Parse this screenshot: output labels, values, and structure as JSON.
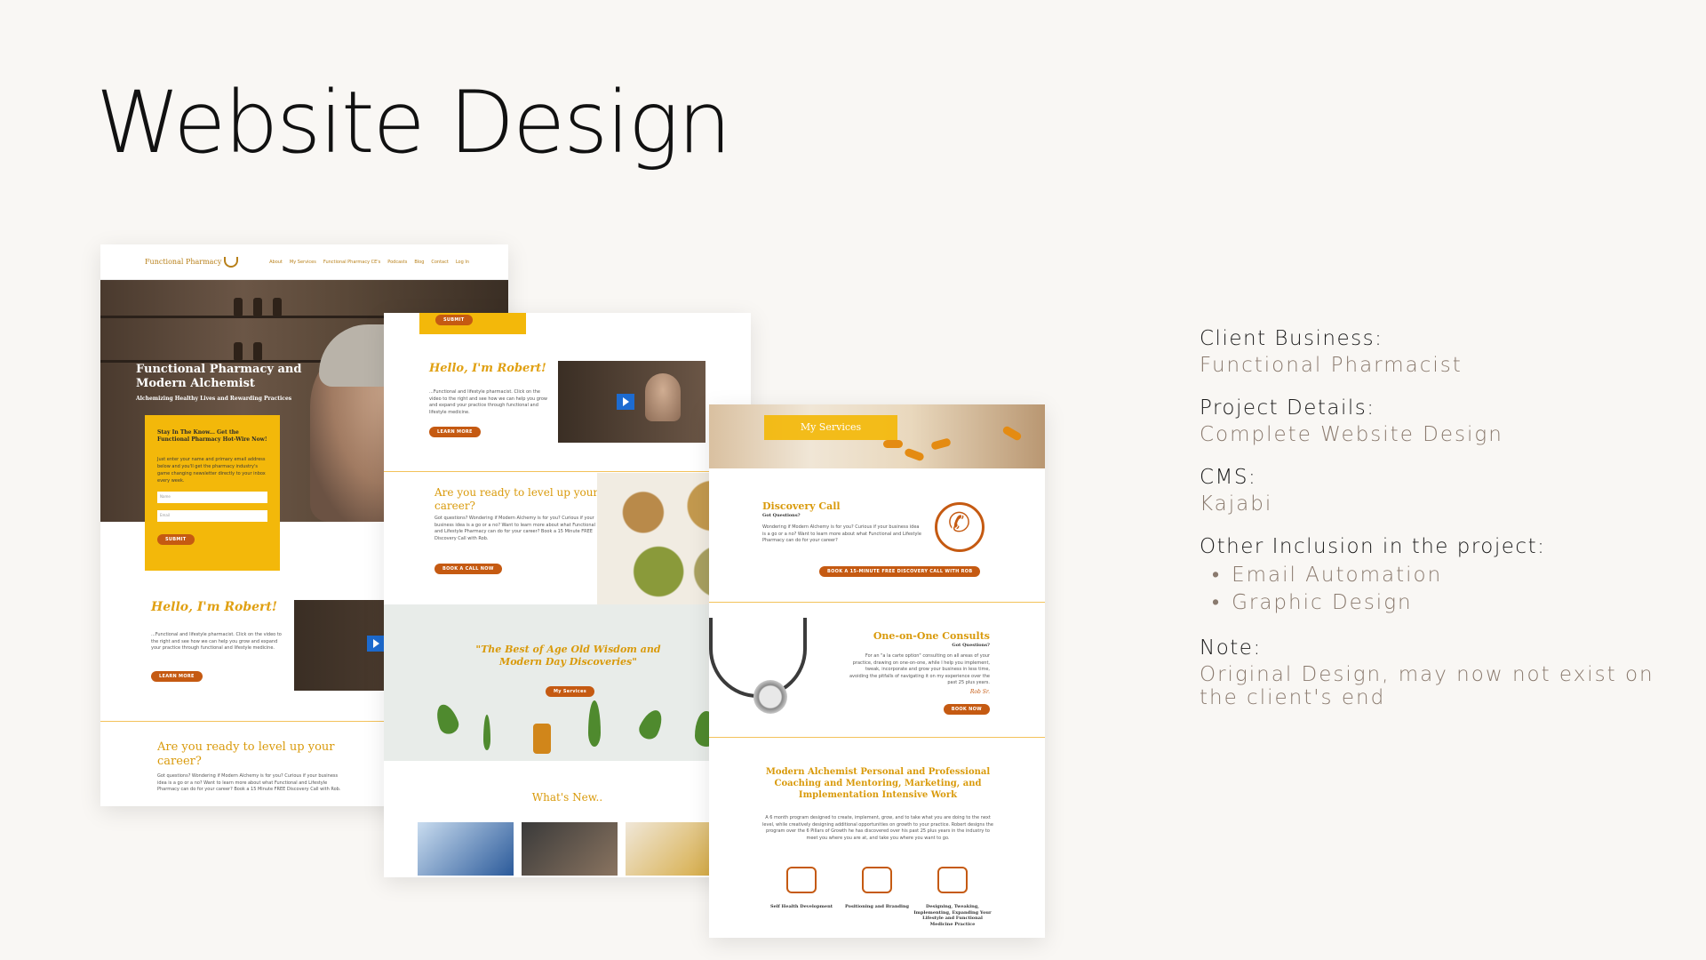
{
  "title": "Website Design",
  "info": {
    "client_label": "Client Business:",
    "client_value": "Functional Pharmacist",
    "project_label": "Project Details:",
    "project_value": "Complete Website Design",
    "cms_label": "CMS:",
    "cms_value": "Kajabi",
    "other_label": "Other Inclusion in the project:",
    "other_items": [
      "Email Automation",
      "Graphic Design"
    ],
    "note_label": "Note:",
    "note_value": "Original Design, may now not exist on the client's end"
  },
  "page1": {
    "logo": "Functional Pharmacy",
    "nav": [
      "About",
      "My Services",
      "Functional Pharmacy CE's",
      "Podcasts",
      "Blog",
      "Contact",
      "Log In"
    ],
    "hero_title": "Functional Pharmacy and Modern Alchemist",
    "hero_sub": "Alchemizing Healthy Lives and Rewarding Practices",
    "optin_heading": "Stay In The Know... Get the Functional Pharmacy Hot-Wire Now!",
    "optin_text": "Just enter your name and primary email address below and you'll get the pharmacy industry's game changing newsletter directly to your inbox every week.",
    "optin_name_placeholder": "Name",
    "optin_email_placeholder": "Email",
    "optin_button": "SUBMIT",
    "hello_title": "Hello, I'm Robert!",
    "hello_text": "...Functional and lifestyle pharmacist. Click on the video to the right and see how we can help you grow and expand your practice through functional and lifestyle medicine.",
    "hello_button": "LEARN MORE",
    "ready_title": "Are you ready to level up your career?",
    "ready_text": "Got questions? Wondering if Modern Alchemy is for you? Curious if your business idea is a go or a no? Want to learn more about what Functional and Lifestyle Pharmacy can do for your career? Book a 15 Minute FREE Discovery Call with Rob."
  },
  "page2": {
    "submit_button": "SUBMIT",
    "hello_title": "Hello, I'm Robert!",
    "hello_text": "...Functional and lifestyle pharmacist. Click on the video to the right and see how we can help you grow and expand your practice through functional and lifestyle medicine.",
    "hello_button": "LEARN MORE",
    "ready_title": "Are you ready to level up your career?",
    "ready_text": "Got questions? Wondering if Modern Alchemy is for you? Curious if your business idea is a go or a no? Want to learn more about what Functional and Lifestyle Pharmacy can do for your career? Book a 15 Minute FREE Discovery Call with Rob.",
    "ready_button": "BOOK A CALL NOW",
    "quote": "\"The Best of Age Old Wisdom and Modern Day Discoveries\"",
    "quote_button": "My Services",
    "whats_new": "What's New.."
  },
  "page3": {
    "banner": "My Services",
    "discovery_title": "Discovery Call",
    "discovery_sub": "Got Questions?",
    "discovery_text": "Wondering if Modern Alchemy is for you? Curious if your business idea is a go or a no? Want to learn more about what Functional and Lifestyle Pharmacy can do for your career?",
    "discovery_button": "BOOK A 15-MINUTE FREE DISCOVERY CALL WITH ROB",
    "consult_title": "One-on-One Consults",
    "consult_sub": "Got Questions?",
    "consult_text": "For an \"a la carte option\" consulting on all areas of your practice, drawing on one-on-one, while I help you implement, tweak, incorporate and grow your business in less time, avoiding the pitfalls of navigating it on my experience over the past 25 plus years.",
    "consult_sig": "Rob Sr.",
    "consult_button": "BOOK NOW",
    "modern_title": "Modern Alchemist Personal and Professional Coaching and Mentoring, Marketing, and Implementation Intensive Work",
    "modern_text": "A 6 month program designed to create, implement, grow, and to take what you are doing to the next level, while creatively designing additional opportunities on growth to your practice. Robert designs the program over the 6 Pillars of Growth he has discovered over his past 25 plus years in the industry to meet you where you are at, and take you where you want to go.",
    "icon_labels": [
      "Self Health Development",
      "Positioning and Branding",
      "Designing, Tweaking, Implementing, Expanding Your Lifestyle and Functional Medicine Practice"
    ]
  }
}
